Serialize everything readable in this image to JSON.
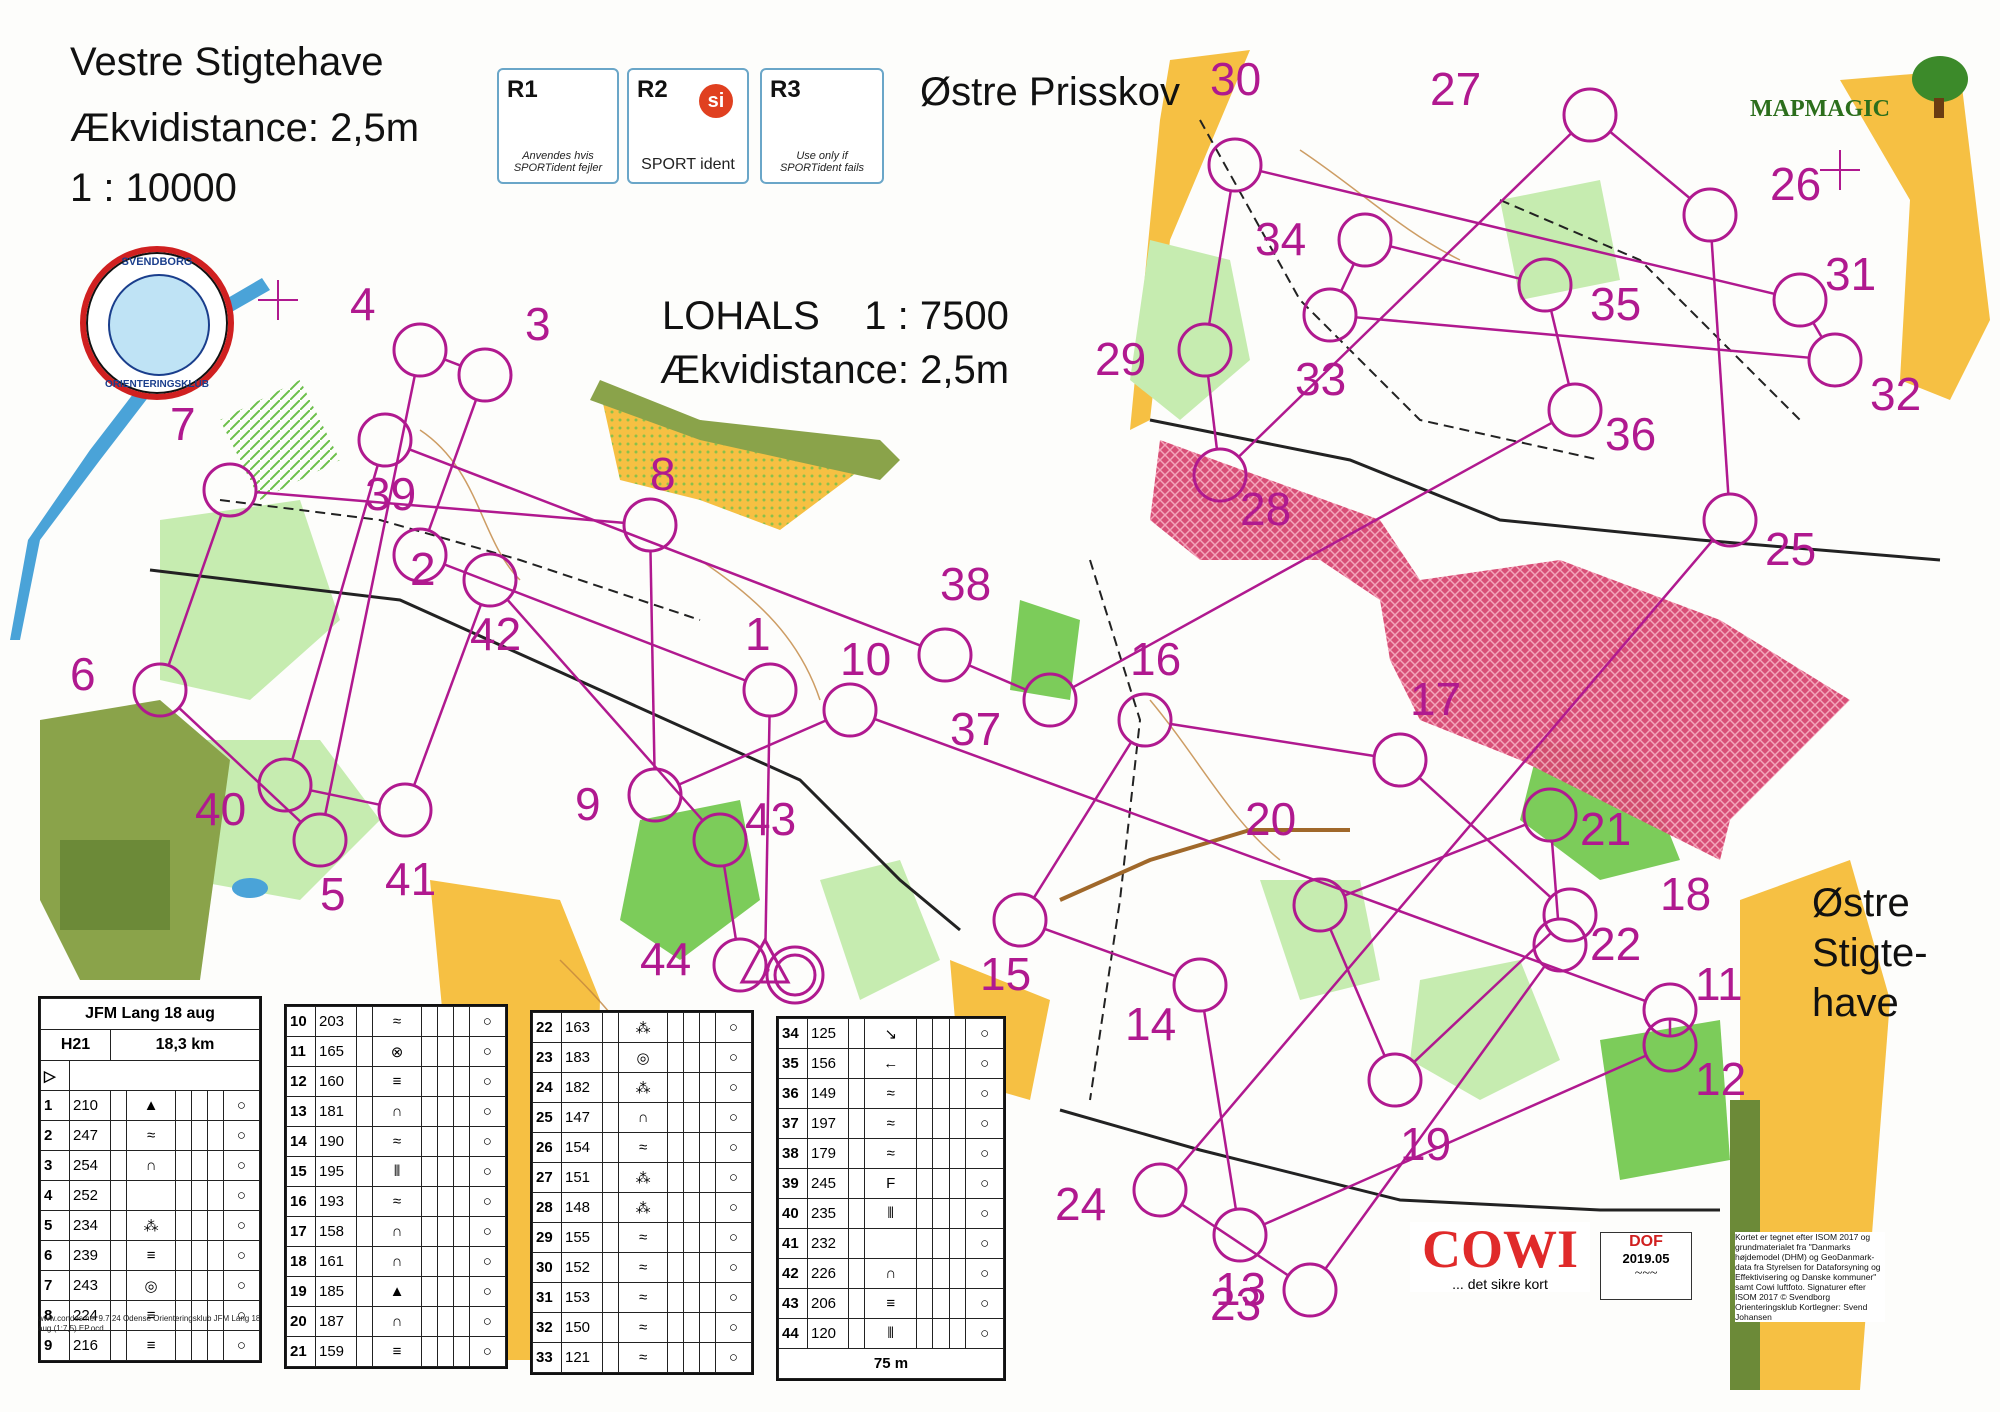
{
  "titles": {
    "vestre": "Vestre Stigtehave",
    "ekvi_left": "Ækvidistance: 2,5m",
    "scale_left": "1 : 10000",
    "lohals": "LOHALS    1 : 7500",
    "ekvi_mid": "Ækvidistance: 2,5m",
    "ostre_prisskov": "Østre Prisskov",
    "ostre_stigtehave": [
      "Østre",
      "Stigte-",
      "have"
    ]
  },
  "si_boxes": [
    {
      "title": "R1",
      "sub": "Anvendes hvis SPORTident fejler"
    },
    {
      "title": "R2",
      "sub": "SPORT ident",
      "logo": "si"
    },
    {
      "title": "R3",
      "sub": "Use only if SPORTident fails"
    }
  ],
  "club_logo": {
    "top": "SVENDBORG",
    "bottom": "ORIENTERINGSKLUB"
  },
  "brand": "MAPMAGIC",
  "sponsor": {
    "name": "COWI",
    "tagline": "... det sikre kort"
  },
  "dof": {
    "code": "DOF",
    "version": "2019.05"
  },
  "credits": "Kortet er tegnet efter ISOM 2017 og grundmaterialet fra \"Danmarks højdemodel (DHM) og GeoDanmark-data fra Styrelsen for Dataforsyning og Effektivisering og Danske kommuner\" samt Cowi luftfoto. Signaturer efter ISOM 2017 © Svendborg Orienteringsklub Kortlegner: Svend Johansen",
  "course": {
    "header": "JFM Lang 18 aug",
    "class": "H21",
    "length": "18,3 km",
    "scale_note": "75 m",
    "footer": "www.condes.net 9.7.24 Odense Orienteringsklub JFM Lang 18 aug (1:7,5) EP.ocd",
    "controls": [
      {
        "n": "1",
        "code": "210",
        "sym": "▲"
      },
      {
        "n": "2",
        "code": "247",
        "sym": "≈"
      },
      {
        "n": "3",
        "code": "254",
        "sym": "∩"
      },
      {
        "n": "4",
        "code": "252",
        "sym": ""
      },
      {
        "n": "5",
        "code": "234",
        "sym": "⁂"
      },
      {
        "n": "6",
        "code": "239",
        "sym": "≡"
      },
      {
        "n": "7",
        "code": "243",
        "sym": "◎"
      },
      {
        "n": "8",
        "code": "224",
        "sym": "≡"
      },
      {
        "n": "9",
        "code": "216",
        "sym": "≡"
      },
      {
        "n": "10",
        "code": "203",
        "sym": "≈"
      },
      {
        "n": "11",
        "code": "165",
        "sym": "⊗"
      },
      {
        "n": "12",
        "code": "160",
        "sym": "≡"
      },
      {
        "n": "13",
        "code": "181",
        "sym": "∩"
      },
      {
        "n": "14",
        "code": "190",
        "sym": "≈"
      },
      {
        "n": "15",
        "code": "195",
        "sym": "⦀"
      },
      {
        "n": "16",
        "code": "193",
        "sym": "≈"
      },
      {
        "n": "17",
        "code": "158",
        "sym": "∩"
      },
      {
        "n": "18",
        "code": "161",
        "sym": "∩"
      },
      {
        "n": "19",
        "code": "185",
        "sym": "▲"
      },
      {
        "n": "20",
        "code": "187",
        "sym": "∩"
      },
      {
        "n": "21",
        "code": "159",
        "sym": "≡"
      },
      {
        "n": "22",
        "code": "163",
        "sym": "⁂"
      },
      {
        "n": "23",
        "code": "183",
        "sym": "◎"
      },
      {
        "n": "24",
        "code": "182",
        "sym": "⁂"
      },
      {
        "n": "25",
        "code": "147",
        "sym": "∩"
      },
      {
        "n": "26",
        "code": "154",
        "sym": "≈"
      },
      {
        "n": "27",
        "code": "151",
        "sym": "⁂"
      },
      {
        "n": "28",
        "code": "148",
        "sym": "⁂"
      },
      {
        "n": "29",
        "code": "155",
        "sym": "≈"
      },
      {
        "n": "30",
        "code": "152",
        "sym": "≈"
      },
      {
        "n": "31",
        "code": "153",
        "sym": "≈"
      },
      {
        "n": "32",
        "code": "150",
        "sym": "≈"
      },
      {
        "n": "33",
        "code": "121",
        "sym": "≈"
      },
      {
        "n": "34",
        "code": "125",
        "sym": "↘"
      },
      {
        "n": "35",
        "code": "156",
        "sym": "←"
      },
      {
        "n": "36",
        "code": "149",
        "sym": "≈"
      },
      {
        "n": "37",
        "code": "197",
        "sym": "≈"
      },
      {
        "n": "38",
        "code": "179",
        "sym": "≈"
      },
      {
        "n": "39",
        "code": "245",
        "sym": "F"
      },
      {
        "n": "40",
        "code": "235",
        "sym": "⦀"
      },
      {
        "n": "41",
        "code": "232",
        "sym": ""
      },
      {
        "n": "42",
        "code": "226",
        "sym": "∩"
      },
      {
        "n": "43",
        "code": "206",
        "sym": "≡"
      },
      {
        "n": "44",
        "code": "120",
        "sym": "⦀"
      }
    ]
  },
  "control_labels": [
    "1",
    "2",
    "3",
    "4",
    "5",
    "6",
    "7",
    "8",
    "9",
    "10",
    "11",
    "12",
    "13",
    "14",
    "15",
    "16",
    "17",
    "18",
    "19",
    "20",
    "21",
    "22",
    "23",
    "24",
    "25",
    "26",
    "27",
    "28",
    "29",
    "30",
    "31",
    "32",
    "33",
    "34",
    "35",
    "36",
    "37",
    "38",
    "39",
    "40",
    "41",
    "42",
    "43",
    "44"
  ],
  "colors": {
    "course": "#b0198f",
    "green": "#7ccc5a",
    "lightgreen": "#c6ecb0",
    "yellow": "#f6c043",
    "olive": "#8aa34a",
    "water": "#4aa3d8",
    "out_of_bounds": "#d64670"
  }
}
